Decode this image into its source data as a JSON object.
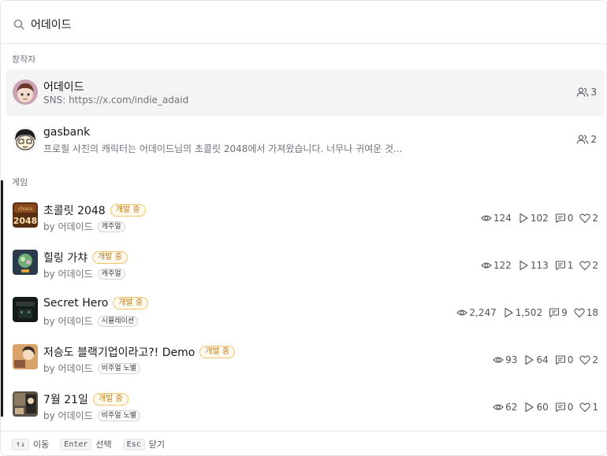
{
  "search": {
    "value": "어데이드",
    "icon": "search-icon"
  },
  "sections": {
    "creators": "창작자",
    "games": "게임"
  },
  "creators": [
    {
      "name": "어데이드",
      "sub": "SNS: https://x.com/indie_adaid",
      "followers": "3"
    },
    {
      "name": "gasbank",
      "sub": "프로필 사진의 캐릭터는 어데이드님의 초콜릿 2048에서 가져왔습니다. 너무나 귀여운 것...",
      "followers": "2"
    }
  ],
  "games": [
    {
      "title": "초콜릿 2048",
      "badge": "개발 중",
      "by": "by 어데이드",
      "tag": "캐주얼",
      "views": "124",
      "plays": "102",
      "comments": "0",
      "likes": "2"
    },
    {
      "title": "힐링 가챠",
      "badge": "개발 중",
      "by": "by 어데이드",
      "tag": "캐주얼",
      "views": "122",
      "plays": "113",
      "comments": "1",
      "likes": "2"
    },
    {
      "title": "Secret Hero",
      "badge": "개발 중",
      "by": "by 어데이드",
      "tag": "시뮬레이션",
      "views": "2,247",
      "plays": "1,502",
      "comments": "9",
      "likes": "18"
    },
    {
      "title": "저승도 블랙기업이라고?! Demo",
      "badge": "개발 중",
      "by": "by 어데이드",
      "tag": "비주얼 노벨",
      "views": "93",
      "plays": "64",
      "comments": "0",
      "likes": "2"
    },
    {
      "title": "7월 21일",
      "badge": "개발 중",
      "by": "by 어데이드",
      "tag": "비주얼 노벨",
      "views": "62",
      "plays": "60",
      "comments": "0",
      "likes": "1"
    }
  ],
  "footer": {
    "move_key": "↑↓",
    "move_label": "이동",
    "select_key": "Enter",
    "select_label": "선택",
    "close_key": "Esc",
    "close_label": "닫기"
  },
  "colors": {
    "badge_text": "#b7791f",
    "badge_border": "#f0c36d",
    "active_row": "#f4f4f5"
  }
}
